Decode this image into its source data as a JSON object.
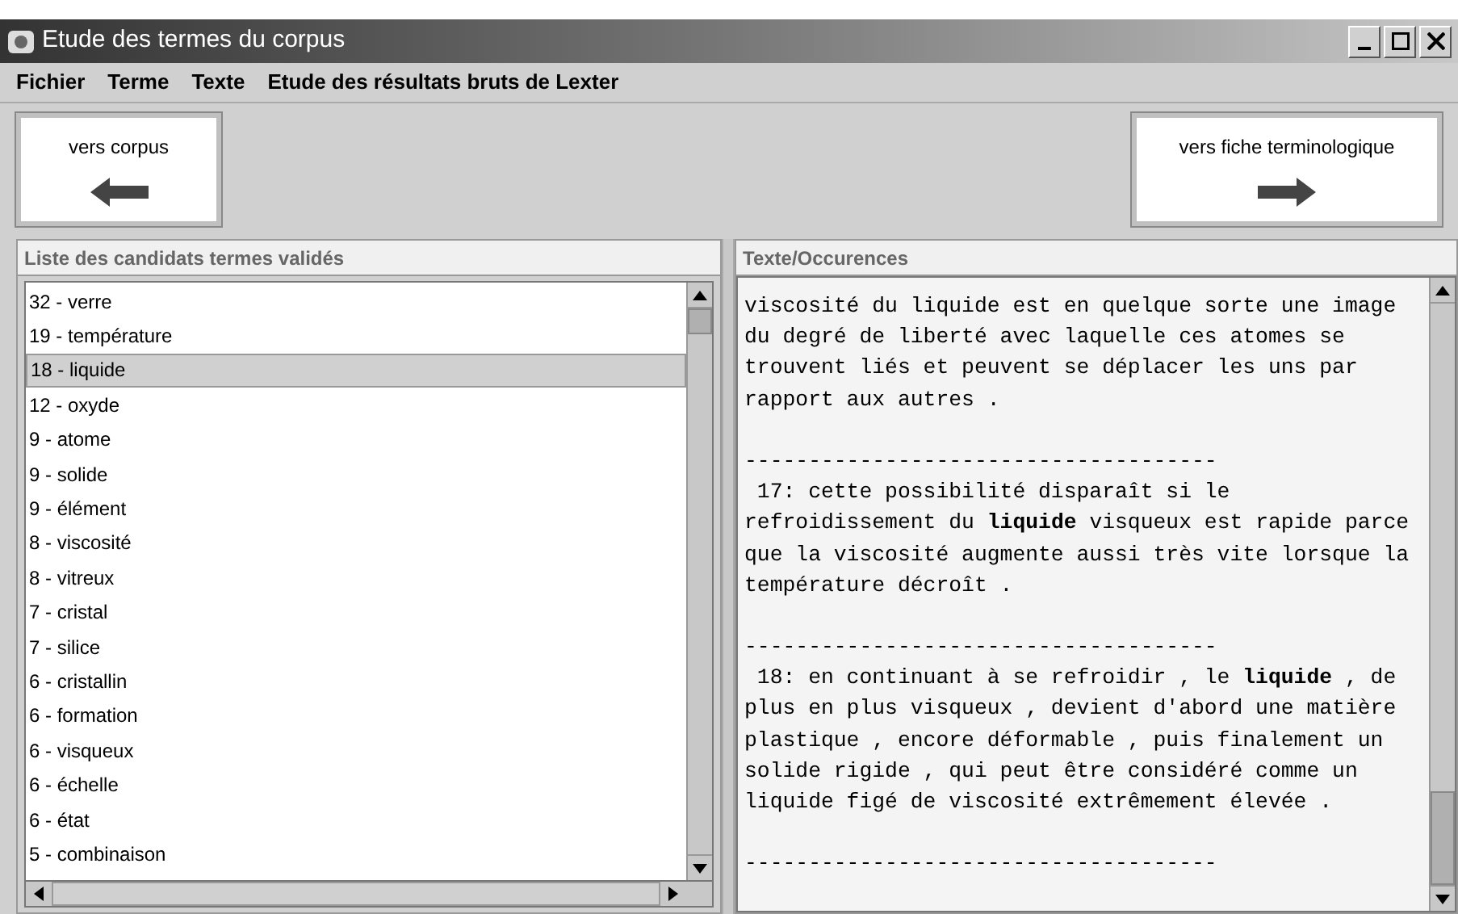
{
  "window": {
    "title": "Etude des termes du corpus"
  },
  "menu": [
    "Fichier",
    "Terme",
    "Texte",
    "Etude des résultats bruts de Lexter"
  ],
  "toolbar": {
    "left_button": {
      "label": "vers corpus"
    },
    "right_button": {
      "label": "vers fiche terminologique"
    }
  },
  "terms_panel": {
    "title": "Liste des candidats termes validés",
    "items": [
      {
        "label": "32 - verre",
        "selected": false
      },
      {
        "label": "19 - température",
        "selected": false
      },
      {
        "label": "18 - liquide",
        "selected": true
      },
      {
        "label": "12 - oxyde",
        "selected": false
      },
      {
        "label": "9 - atome",
        "selected": false
      },
      {
        "label": "9 - solide",
        "selected": false
      },
      {
        "label": "9 - élément",
        "selected": false
      },
      {
        "label": "8 - viscosité",
        "selected": false
      },
      {
        "label": "8 - vitreux",
        "selected": false
      },
      {
        "label": "7 - cristal",
        "selected": false
      },
      {
        "label": "7 - silice",
        "selected": false
      },
      {
        "label": "6 - cristallin",
        "selected": false
      },
      {
        "label": "6 - formation",
        "selected": false
      },
      {
        "label": "6 - visqueux",
        "selected": false
      },
      {
        "label": "6 - échelle",
        "selected": false
      },
      {
        "label": "6 - état",
        "selected": false
      },
      {
        "label": "5 - combinaison",
        "selected": false
      }
    ]
  },
  "text_panel": {
    "title": "Texte/Occurences",
    "lines": [
      {
        "kind": "text",
        "text": "viscosité du liquide est en quelque sorte une image"
      },
      {
        "kind": "text",
        "text": "du degré de liberté avec laquelle ces atomes se"
      },
      {
        "kind": "text",
        "text": "trouvent liés et peuvent se déplacer les uns par"
      },
      {
        "kind": "text",
        "text": "rapport aux autres ."
      },
      {
        "kind": "gap"
      },
      {
        "kind": "text",
        "text": "-------------------------------------"
      },
      {
        "kind": "text",
        "text": " 17: cette possibilité disparaît si le"
      },
      {
        "kind": "text",
        "text": "refroidissement du **liquide** visqueux est rapide parce"
      },
      {
        "kind": "text",
        "text": "que la viscosité augmente aussi très vite lorsque la"
      },
      {
        "kind": "text",
        "text": "température décroît ."
      },
      {
        "kind": "gap"
      },
      {
        "kind": "text",
        "text": "-------------------------------------"
      },
      {
        "kind": "text",
        "text": " 18: en continuant à se refroidir , le **liquide** , de"
      },
      {
        "kind": "text",
        "text": "plus en plus visqueux , devient d'abord une matière"
      },
      {
        "kind": "text",
        "text": "plastique , encore déformable , puis finalement un"
      },
      {
        "kind": "text",
        "text": "solide rigide , qui peut être considéré comme un"
      },
      {
        "kind": "text",
        "text": "liquide figé de viscosité extrêmement élevée ."
      },
      {
        "kind": "gap"
      },
      {
        "kind": "text",
        "text": "-------------------------------------"
      }
    ]
  }
}
